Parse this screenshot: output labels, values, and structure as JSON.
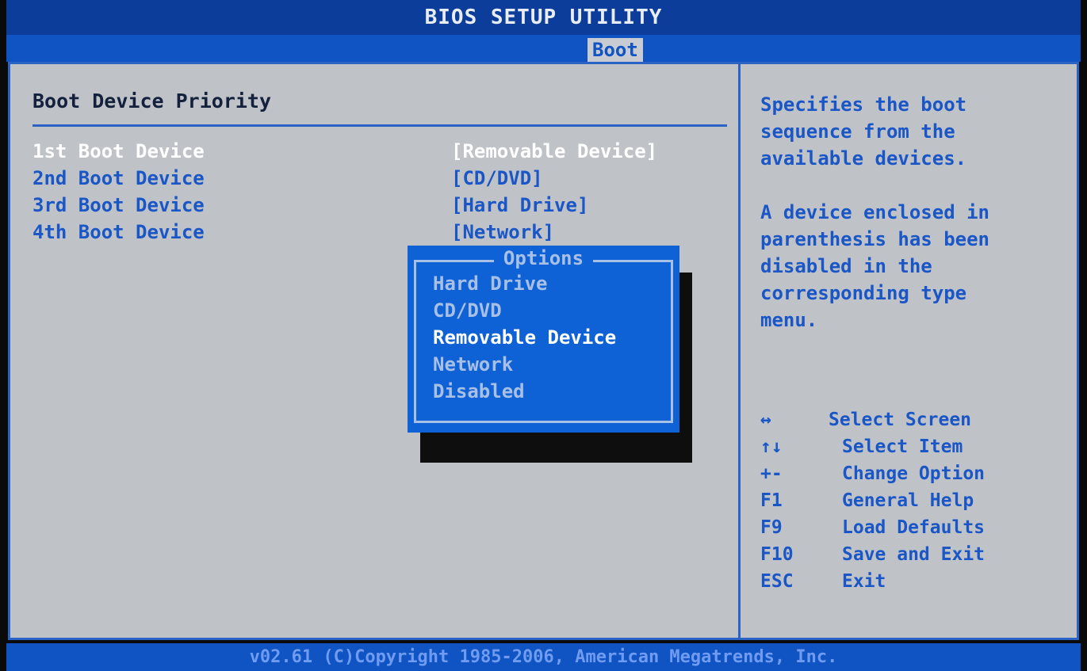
{
  "header": {
    "title": "BIOS SETUP UTILITY",
    "active_tab": "Boot"
  },
  "main": {
    "section_title": "Boot Device Priority",
    "boot_devices": [
      {
        "label": "1st Boot Device",
        "value": "[Removable Device]"
      },
      {
        "label": "2nd Boot Device",
        "value": "[CD/DVD]"
      },
      {
        "label": "3rd Boot Device",
        "value": "[Hard Drive]"
      },
      {
        "label": "4th Boot Device",
        "value": "[Network]"
      }
    ]
  },
  "popup": {
    "title": "Options",
    "options": [
      "Hard Drive",
      "CD/DVD",
      "Removable Device",
      "Network",
      "Disabled"
    ],
    "highlighted": "Removable Device"
  },
  "help": {
    "lines_1": [
      "Specifies the boot",
      "sequence from the",
      "available devices."
    ],
    "lines_2": [
      "A device enclosed in",
      "parenthesis has been",
      "disabled in the",
      "corresponding type",
      "menu."
    ]
  },
  "keys": [
    {
      "key": "↔",
      "desc": "Select Screen"
    },
    {
      "key": "↑↓",
      "desc": "Select Item"
    },
    {
      "key": "+-",
      "desc": "Change Option"
    },
    {
      "key": "F1",
      "desc": "General Help"
    },
    {
      "key": "F9",
      "desc": "Load Defaults"
    },
    {
      "key": "F10",
      "desc": "Save and Exit"
    },
    {
      "key": "ESC",
      "desc": "Exit"
    }
  ],
  "footer": {
    "text": "v02.61 (C)Copyright 1985-2006, American Megatrends, Inc."
  },
  "colors": {
    "bar_blue": "#1053c2",
    "panel_grey": "#bfc3c8",
    "text_blue": "#1a56c6",
    "popup_blue": "#0f62d6",
    "highlight_white": "#ffffff"
  }
}
